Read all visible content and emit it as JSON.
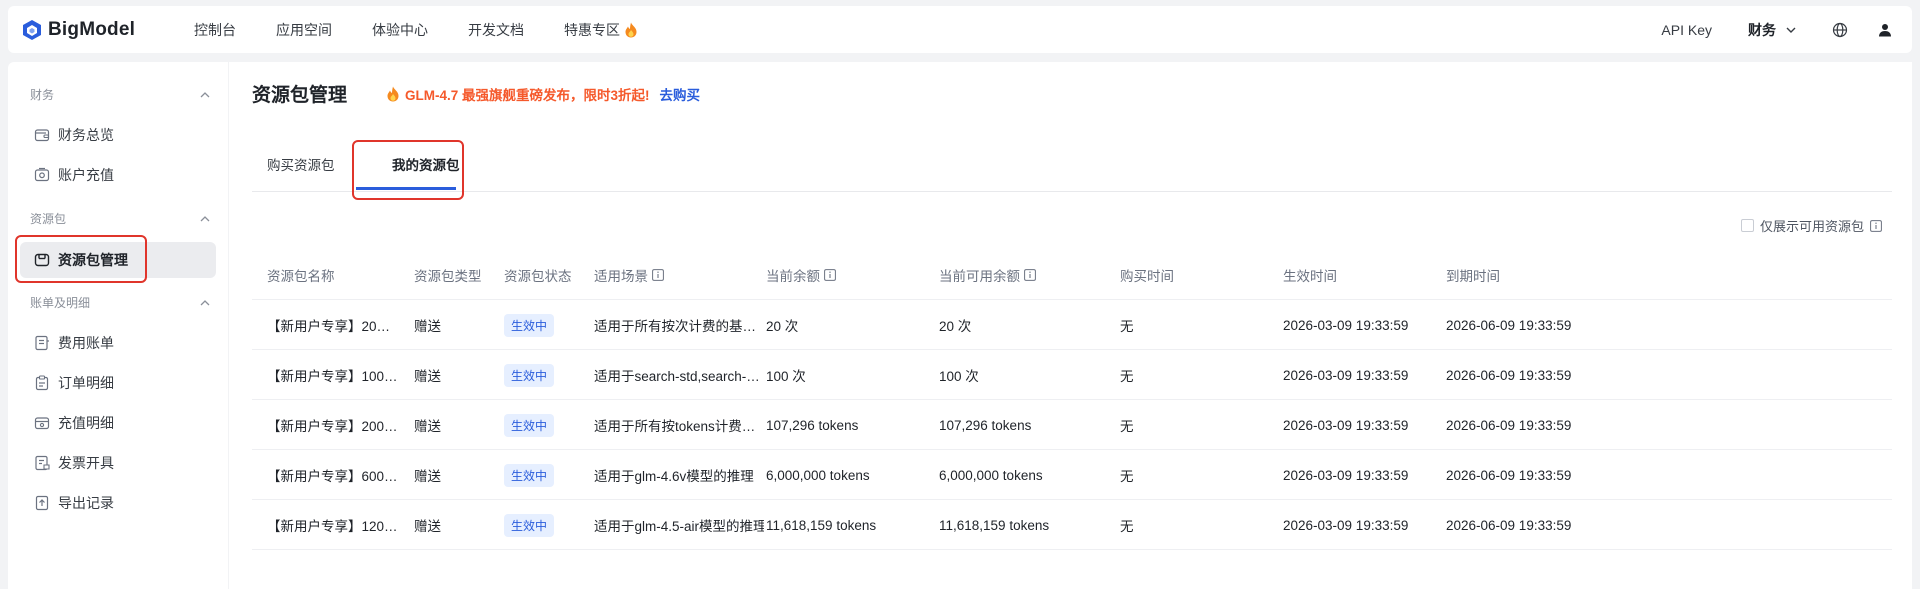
{
  "brand": {
    "name": "BigModel",
    "accent": "#2a5ddc"
  },
  "nav": {
    "items": [
      "控制台",
      "应用空间",
      "体验中心",
      "开发文档",
      "特惠专区"
    ]
  },
  "top_right": {
    "api_key": "API Key",
    "role": "财务"
  },
  "sidebar": {
    "groups": [
      {
        "title": "财务",
        "items": [
          "财务总览",
          "账户充值"
        ]
      },
      {
        "title": "资源包",
        "items": [
          "资源包管理"
        ]
      },
      {
        "title": "账单及明细",
        "items": [
          "费用账单",
          "订单明细",
          "充值明细",
          "发票开具",
          "导出记录"
        ]
      }
    ],
    "active": "资源包管理"
  },
  "page": {
    "title": "资源包管理",
    "promo_text": "GLM-4.7 最强旗舰重磅发布，限时3折起!",
    "promo_link": "去购买"
  },
  "tabs": [
    {
      "label": "购买资源包",
      "active": false
    },
    {
      "label": "我的资源包",
      "active": true
    }
  ],
  "filter_label": "仅展示可用资源包",
  "table": {
    "columns": [
      "资源包名称",
      "资源包类型",
      "资源包状态",
      "适用场景",
      "当前余额",
      "当前可用余额",
      "购买时间",
      "生效时间",
      "到期时间"
    ],
    "rows": [
      [
        "【新用户专享】20…",
        "赠送",
        "生效中",
        "适用于所有按次计费的基…",
        "20 次",
        "20 次",
        "无",
        "2026-03-09 19:33:59",
        "2026-06-09 19:33:59"
      ],
      [
        "【新用户专享】100…",
        "赠送",
        "生效中",
        "适用于search-std,search-…",
        "100 次",
        "100 次",
        "无",
        "2026-03-09 19:33:59",
        "2026-06-09 19:33:59"
      ],
      [
        "【新用户专享】200…",
        "赠送",
        "生效中",
        "适用于所有按tokens计费…",
        "107,296 tokens",
        "107,296 tokens",
        "无",
        "2026-03-09 19:33:59",
        "2026-06-09 19:33:59"
      ],
      [
        "【新用户专享】600…",
        "赠送",
        "生效中",
        "适用于glm-4.6v模型的推理",
        "6,000,000 tokens",
        "6,000,000 tokens",
        "无",
        "2026-03-09 19:33:59",
        "2026-06-09 19:33:59"
      ],
      [
        "【新用户专享】120…",
        "赠送",
        "生效中",
        "适用于glm-4.5-air模型的推理",
        "11,618,159 tokens",
        "11,618,159 tokens",
        "无",
        "2026-03-09 19:33:59",
        "2026-06-09 19:33:59"
      ]
    ]
  }
}
